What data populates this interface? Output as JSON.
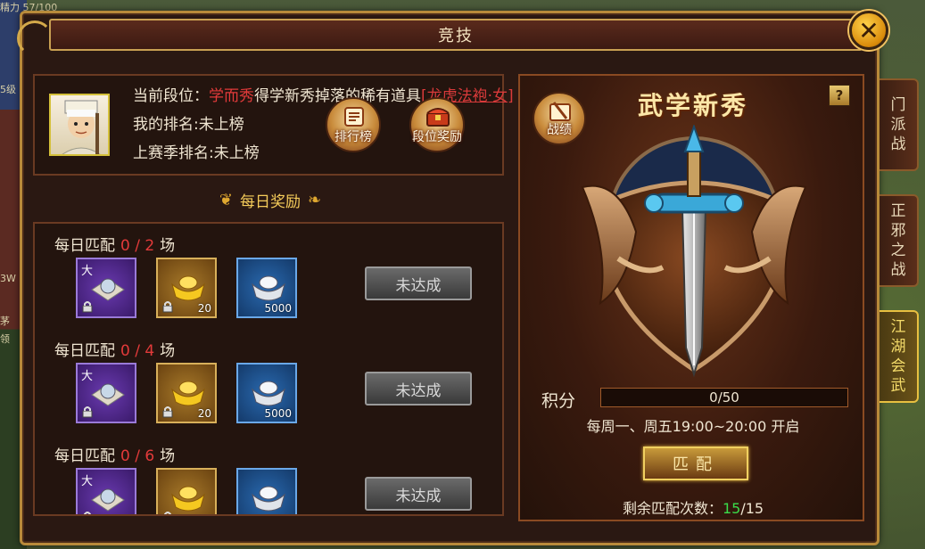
{
  "window": {
    "title": "竞技"
  },
  "profile": {
    "line1_prefix": "当前段位：",
    "line1_overlay": "学而秀",
    "line1_mid": "得学新秀掉落的稀有道具",
    "line1_item": "[龙虎法袍·女]",
    "rank_line": "我的排名:未上榜",
    "last_season_line": "上赛季排名:未上榜",
    "leaderboard_btn": "排行榜",
    "tier_reward_btn": "段位奖励"
  },
  "daily": {
    "title": "每日奖励",
    "rows": [
      {
        "label": "每日匹配",
        "progress": "0 / 2",
        "unit": "场",
        "status": "未达成",
        "slots": [
          {
            "kind": "purple",
            "tag": "大",
            "count": ""
          },
          {
            "kind": "gold",
            "tag": "",
            "count": "20"
          },
          {
            "kind": "blue",
            "tag": "",
            "count": "5000"
          }
        ]
      },
      {
        "label": "每日匹配",
        "progress": "0 / 4",
        "unit": "场",
        "status": "未达成",
        "slots": [
          {
            "kind": "purple",
            "tag": "大",
            "count": ""
          },
          {
            "kind": "gold",
            "tag": "",
            "count": "20"
          },
          {
            "kind": "blue",
            "tag": "",
            "count": "5000"
          }
        ]
      },
      {
        "label": "每日匹配",
        "progress": "0 / 6",
        "unit": "场",
        "status": "未达成",
        "slots": [
          {
            "kind": "purple",
            "tag": "大",
            "count": ""
          },
          {
            "kind": "gold",
            "tag": "",
            "count": ""
          },
          {
            "kind": "blue",
            "tag": "",
            "count": ""
          }
        ]
      }
    ]
  },
  "rank": {
    "tier_name": "武学新秀",
    "help_label": "?",
    "record_btn": "战绩",
    "score_label": "积分",
    "score_text": "0/50",
    "score_fraction": 0,
    "schedule": "每周一、周五19:00~20:00 开启",
    "match_btn": "匹配",
    "remaining_prefix": "剩余匹配次数：",
    "remaining_current": "15",
    "remaining_total": "/15"
  },
  "side_tabs": [
    "门派战",
    "正邪之战",
    "江湖会武"
  ],
  "background": {
    "top_left_text": "精力 57/100",
    "left_texts": [
      "5级",
      "3W",
      "茅",
      "领"
    ]
  }
}
